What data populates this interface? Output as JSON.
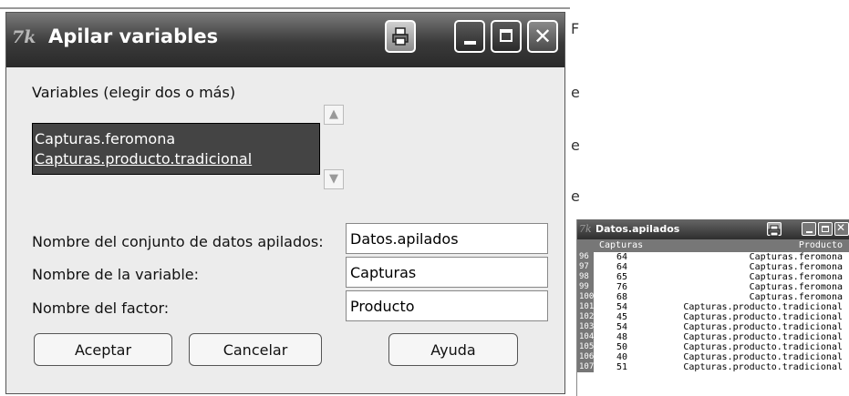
{
  "background": {
    "edge_chars": [
      "e",
      "e",
      "e",
      "F"
    ]
  },
  "dialog": {
    "title": "Apilar variables",
    "logo": "7k",
    "icons": {
      "print": "printer-icon",
      "minimize": "minimize-icon",
      "maximize": "maximize-icon",
      "close": "close-icon"
    },
    "variables_label": "Variables (elegir dos o más)",
    "variables": [
      "Capturas.feromona",
      "Capturas.producto.tradicional"
    ],
    "fields": {
      "dataset_label": "Nombre del conjunto de datos apilados:",
      "dataset_value": "Datos.apilados",
      "variable_label": "Nombre de la variable:",
      "variable_value": "Capturas",
      "factor_label": "Nombre del factor:",
      "factor_value": "Producto"
    },
    "buttons": {
      "ok": "Aceptar",
      "cancel": "Cancelar",
      "help": "Ayuda"
    }
  },
  "data_window": {
    "title": "Datos.apilados",
    "logo": "7k",
    "columns": [
      "Capturas",
      "Producto"
    ],
    "rows": [
      {
        "n": "96",
        "capturas": "64",
        "producto": "Capturas.feromona"
      },
      {
        "n": "97",
        "capturas": "64",
        "producto": "Capturas.feromona"
      },
      {
        "n": "98",
        "capturas": "65",
        "producto": "Capturas.feromona"
      },
      {
        "n": "99",
        "capturas": "76",
        "producto": "Capturas.feromona"
      },
      {
        "n": "100",
        "capturas": "68",
        "producto": "Capturas.feromona"
      },
      {
        "n": "101",
        "capturas": "54",
        "producto": "Capturas.producto.tradicional"
      },
      {
        "n": "102",
        "capturas": "45",
        "producto": "Capturas.producto.tradicional"
      },
      {
        "n": "103",
        "capturas": "54",
        "producto": "Capturas.producto.tradicional"
      },
      {
        "n": "104",
        "capturas": "48",
        "producto": "Capturas.producto.tradicional"
      },
      {
        "n": "105",
        "capturas": "50",
        "producto": "Capturas.producto.tradicional"
      },
      {
        "n": "106",
        "capturas": "40",
        "producto": "Capturas.producto.tradicional"
      },
      {
        "n": "107",
        "capturas": "51",
        "producto": "Capturas.producto.tradicional"
      }
    ]
  }
}
